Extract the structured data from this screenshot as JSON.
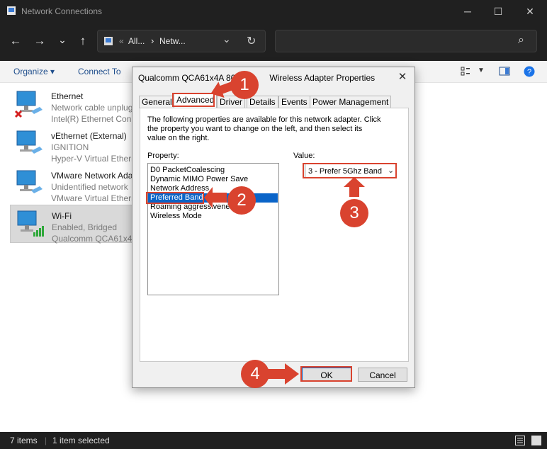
{
  "window": {
    "title": "Network Connections",
    "minimize": "─",
    "maximize": "☐",
    "close": "✕"
  },
  "nav": {
    "back": "←",
    "forward": "→",
    "dropdown": "⌄",
    "up": "↑",
    "breadcrumb_1": "All...",
    "breadcrumb_sep": "›",
    "breadcrumb_2": "Netw...",
    "address_dropdown": "⌄",
    "refresh": "↻",
    "search_icon": "⌕"
  },
  "commandbar": {
    "organize": "Organize ▾",
    "connect_to": "Connect To"
  },
  "connections": [
    {
      "name": "Ethernet",
      "status": "Network cable unplug",
      "adapter": "Intel(R) Ethernet Conn"
    },
    {
      "name": "vEthernet (External)",
      "status": "IGNITION",
      "adapter": "Hyper-V Virtual Ethern"
    },
    {
      "name": "VMware Network Ada",
      "status": "Unidentified network",
      "adapter": "VMware Virtual Ethern"
    },
    {
      "name": "Wi-Fi",
      "status": "Enabled, Bridged",
      "adapter": "Qualcomm QCA61x4A"
    }
  ],
  "statusbar": {
    "items": "7 items",
    "selected": "1 item selected"
  },
  "dialog": {
    "title": "Qualcomm QCA61x4A 80... Wireless Adapter Properties",
    "title_left": "Qualcomm QCA61x4A 80",
    "title_right": "Wireless Adapter Properties",
    "close": "✕",
    "tabs": [
      "General",
      "Advanced",
      "Driver",
      "Details",
      "Events",
      "Power Management"
    ],
    "description": "The following properties are available for this network adapter. Click the property you want to change on the left, and then select its value on the right.",
    "property_label": "Property:",
    "value_label": "Value:",
    "properties": [
      "D0 PacketCoalescing",
      "Dynamic MIMO Power Save",
      "Network Address",
      "Preferred Band",
      "Roaming aggressiveness",
      "Wireless Mode"
    ],
    "selected_property": "Preferred Band",
    "value": "3 - Prefer 5Ghz Band",
    "ok": "OK",
    "cancel": "Cancel"
  },
  "annotations": {
    "step1": "1",
    "step2": "2",
    "step3": "3",
    "step4": "4"
  },
  "colors": {
    "annotation": "#d9432f",
    "selection": "#0a64c8"
  }
}
